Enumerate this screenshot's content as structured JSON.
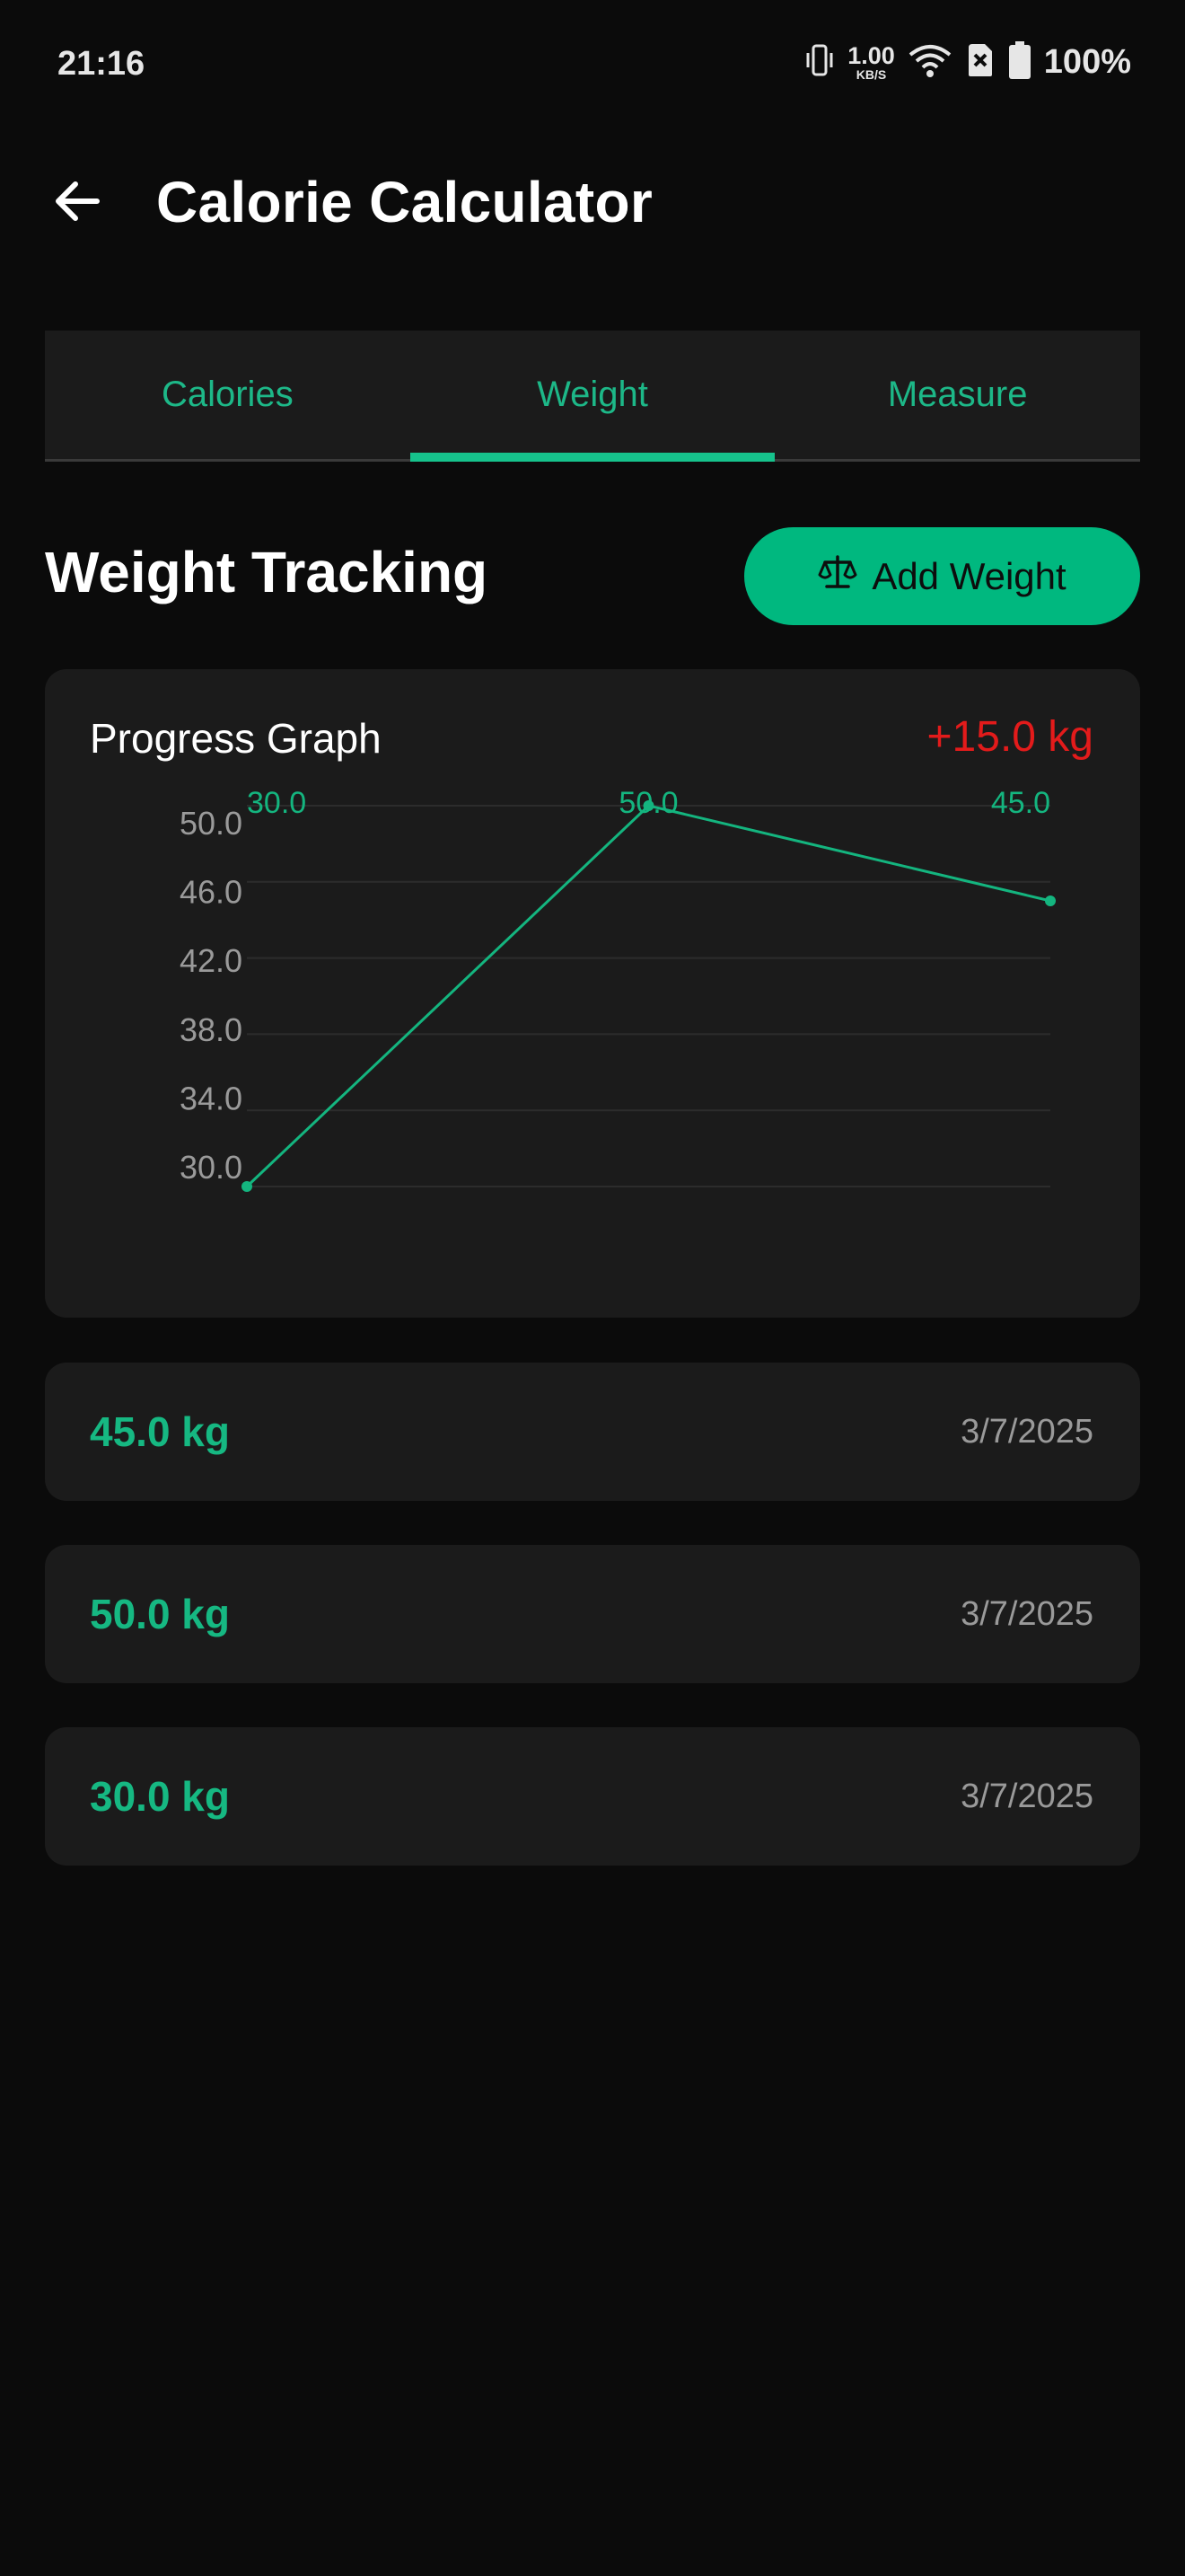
{
  "status_bar": {
    "time": "21:16",
    "net_speed_value": "1.00",
    "net_speed_unit": "KB/S",
    "battery": "100%",
    "icons": [
      "vibrate-icon",
      "wifi-icon",
      "no-sim-icon",
      "battery-icon"
    ]
  },
  "app_bar": {
    "title": "Calorie Calculator",
    "back_icon": "arrow-left-icon"
  },
  "tabs": [
    {
      "label": "Calories",
      "active": false
    },
    {
      "label": "Weight",
      "active": true
    },
    {
      "label": "Measure",
      "active": false
    }
  ],
  "section": {
    "title": "Weight Tracking",
    "add_button_label": "Add Weight",
    "add_button_icon": "scale-icon"
  },
  "graph": {
    "title": "Progress Graph",
    "change": "+15.0 kg"
  },
  "chart_data": {
    "type": "line",
    "title": "Progress Graph",
    "x": [
      1,
      2,
      3
    ],
    "y_ticks": [
      "30.0",
      "34.0",
      "38.0",
      "42.0",
      "46.0",
      "50.0"
    ],
    "ylim": [
      30,
      50
    ],
    "series": [
      {
        "values": [
          30.0,
          50.0,
          45.0
        ],
        "point_labels": [
          "30.0",
          "50.0",
          "45.0"
        ]
      }
    ],
    "grid": true
  },
  "entries": [
    {
      "weight": "45.0 kg",
      "date": "3/7/2025"
    },
    {
      "weight": "50.0 kg",
      "date": "3/7/2025"
    },
    {
      "weight": "30.0 kg",
      "date": "3/7/2025"
    }
  ],
  "colors": {
    "accent": "#00b87f",
    "line": "#14b57f",
    "negative": "#e31b1b",
    "background": "#0b0b0b",
    "card": "#1b1b1b"
  }
}
